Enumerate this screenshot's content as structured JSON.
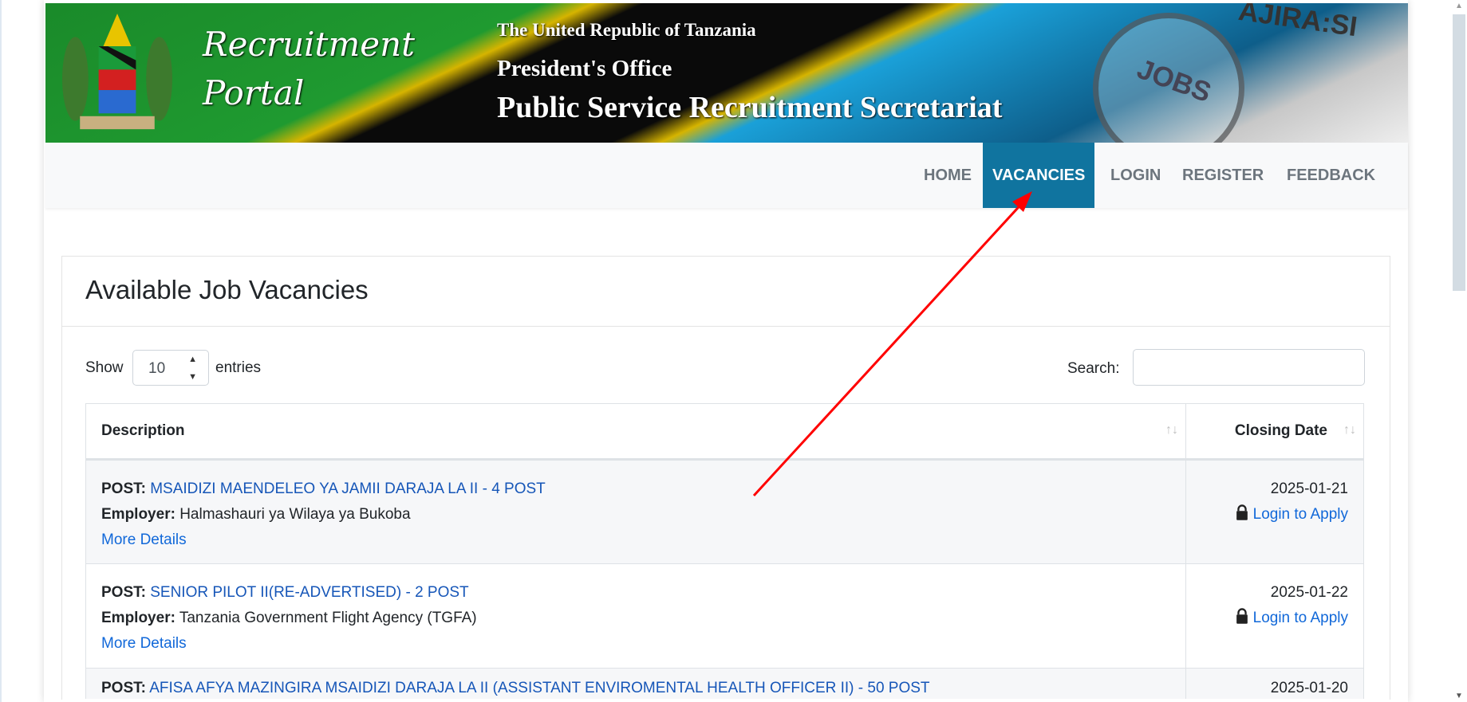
{
  "banner": {
    "portal_line1": "Recruitment",
    "portal_line2": "Portal",
    "line1": "The United Republic of Tanzania",
    "line2": "President's Office",
    "line3": "Public Service Recruitment Secretariat",
    "jobs": "JOBS",
    "ajira": "AJIRA:SI"
  },
  "nav": {
    "items": [
      {
        "label": "HOME"
      },
      {
        "label": "VACANCIES",
        "active": true
      },
      {
        "label": "LOGIN"
      },
      {
        "label": "REGISTER"
      },
      {
        "label": "FEEDBACK"
      }
    ],
    "active_color": "#10749f"
  },
  "card": {
    "title": "Available Job Vacancies"
  },
  "controls": {
    "show_label": "Show",
    "entries_value": "10",
    "entries_label": "entries",
    "search_label": "Search:",
    "search_value": ""
  },
  "table": {
    "headers": [
      "Description",
      "Closing Date"
    ],
    "rows": [
      {
        "post_label": "POST:",
        "post": "MSAIDIZI MAENDELEO YA JAMII DARAJA LA II - 4 POST",
        "employer_label": "Employer:",
        "employer": "Halmashauri ya Wilaya ya Bukoba",
        "details": "More Details",
        "date": "2025-01-21",
        "apply": "Login to Apply"
      },
      {
        "post_label": "POST:",
        "post": "SENIOR PILOT II(RE-ADVERTISED) - 2 POST",
        "employer_label": "Employer:",
        "employer": "Tanzania Government Flight Agency (TGFA)",
        "details": "More Details",
        "date": "2025-01-22",
        "apply": "Login to Apply"
      },
      {
        "post_label": "POST:",
        "post": "AFISA AFYA MAZINGIRA MSAIDIZI DARAJA LA II (ASSISTANT ENVIROMENTAL HEALTH OFFICER II) - 50 POST",
        "date": "2025-01-20"
      }
    ]
  },
  "annotation_color": "#ff0000"
}
